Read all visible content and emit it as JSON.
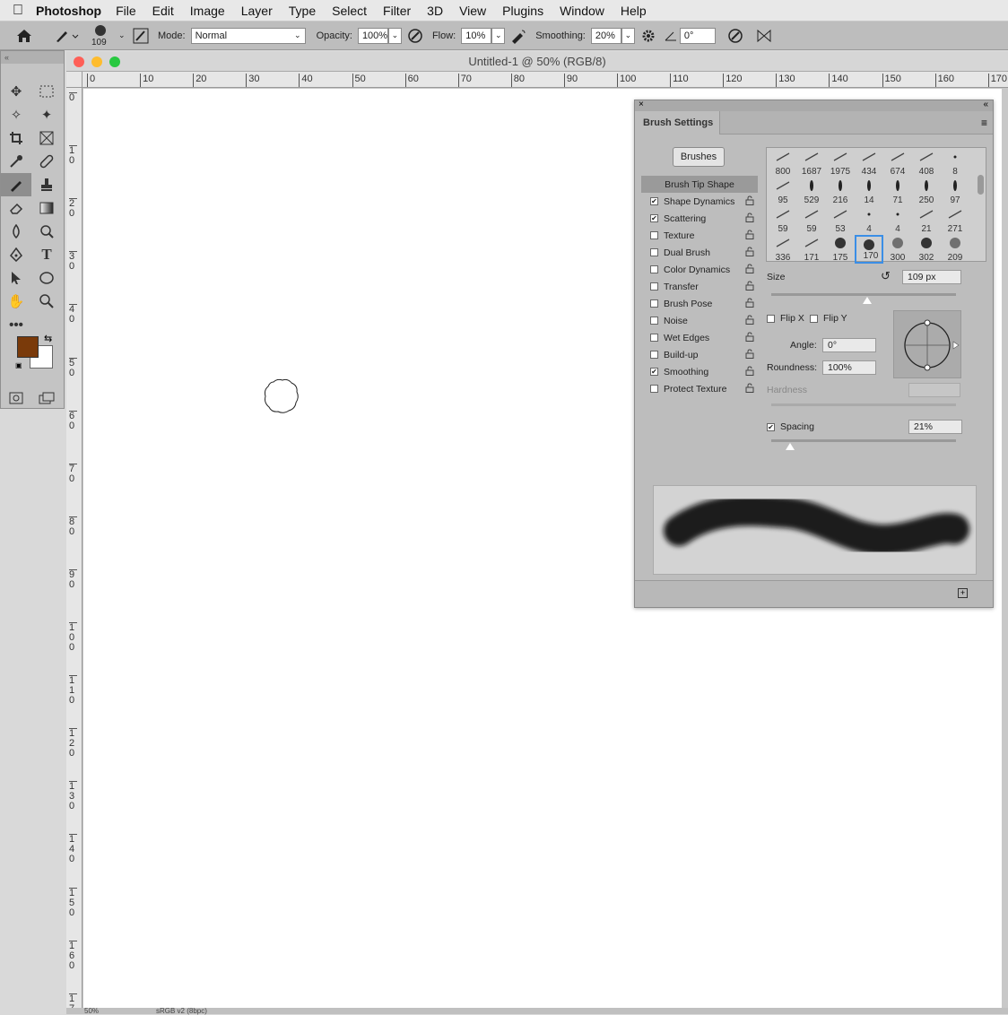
{
  "menubar": {
    "app_name": "Photoshop",
    "items": [
      "File",
      "Edit",
      "Image",
      "Layer",
      "Type",
      "Select",
      "Filter",
      "3D",
      "View",
      "Plugins",
      "Window",
      "Help"
    ]
  },
  "options": {
    "brush_size": "109",
    "mode_label": "Mode:",
    "mode_value": "Normal",
    "opacity_label": "Opacity:",
    "opacity_value": "100%",
    "flow_label": "Flow:",
    "flow_value": "10%",
    "smoothing_label": "Smoothing:",
    "smoothing_value": "20%",
    "angle_value": "0°"
  },
  "document": {
    "title": "Untitled-1 @ 50% (RGB/8)",
    "ruler_h": [
      "0",
      "10",
      "20",
      "30",
      "40",
      "50",
      "60",
      "70",
      "80",
      "90",
      "100",
      "110",
      "120",
      "130",
      "140",
      "150",
      "160",
      "170"
    ],
    "ruler_v": [
      "0",
      "10",
      "20",
      "30",
      "40",
      "50",
      "60",
      "70",
      "80",
      "90",
      "100",
      "110",
      "120",
      "130",
      "140",
      "150",
      "160",
      "17"
    ],
    "status_zoom": "50%",
    "status_profile": "sRGB v2 (8bpc)"
  },
  "colors": {
    "foreground": "#7a3a0a",
    "background": "#ffffff",
    "selection_accent": "#3a8ee6"
  },
  "panel": {
    "tab_label": "Brush Settings",
    "brushes_button": "Brushes",
    "options": [
      {
        "label": "Brush Tip Shape",
        "selected": true,
        "checkbox": false,
        "checked": false
      },
      {
        "label": "Shape Dynamics",
        "checkbox": true,
        "checked": true
      },
      {
        "label": "Scattering",
        "checkbox": true,
        "checked": true
      },
      {
        "label": "Texture",
        "checkbox": true,
        "checked": false
      },
      {
        "label": "Dual Brush",
        "checkbox": true,
        "checked": false
      },
      {
        "label": "Color Dynamics",
        "checkbox": true,
        "checked": false
      },
      {
        "label": "Transfer",
        "checkbox": true,
        "checked": false
      },
      {
        "label": "Brush Pose",
        "checkbox": true,
        "checked": false
      },
      {
        "label": "Noise",
        "checkbox": true,
        "checked": false
      },
      {
        "label": "Wet Edges",
        "checkbox": true,
        "checked": false
      },
      {
        "label": "Build-up",
        "checkbox": true,
        "checked": false
      },
      {
        "label": "Smoothing",
        "checkbox": true,
        "checked": true
      },
      {
        "label": "Protect Texture",
        "checkbox": true,
        "checked": false
      }
    ],
    "brush_presets": [
      "800",
      "1687",
      "1975",
      "434",
      "674",
      "408",
      "8",
      "95",
      "529",
      "216",
      "14",
      "71",
      "250",
      "97",
      "59",
      "59",
      "53",
      "4",
      "4",
      "21",
      "271",
      "336",
      "171",
      "175",
      "170",
      "300",
      "302",
      "209"
    ],
    "selected_preset": "170",
    "size_label": "Size",
    "size_value": "109 px",
    "size_fraction": 0.52,
    "flip_x": "Flip X",
    "flip_y": "Flip Y",
    "angle_label": "Angle:",
    "angle_value": "0°",
    "roundness_label": "Roundness:",
    "roundness_value": "100%",
    "hardness_label": "Hardness",
    "spacing_label": "Spacing",
    "spacing_value": "21%",
    "spacing_fraction": 0.1
  }
}
